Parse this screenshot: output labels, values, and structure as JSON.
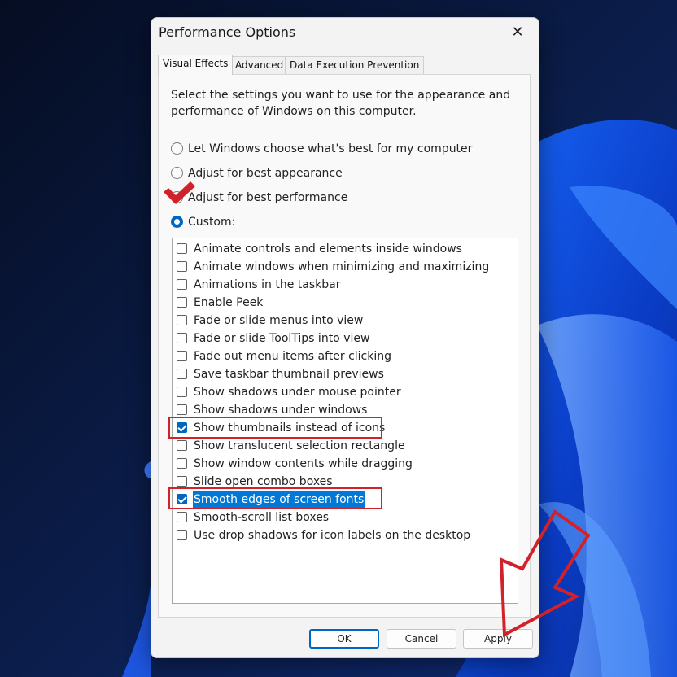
{
  "dialog": {
    "title": "Performance Options",
    "close_icon": "close-icon",
    "tabs": [
      {
        "label": "Visual Effects",
        "active": true
      },
      {
        "label": "Advanced",
        "active": false
      },
      {
        "label": "Data Execution Prevention",
        "active": false
      }
    ],
    "intro": "Select the settings you want to use for the appearance and performance of Windows on this computer.",
    "radio_options": [
      {
        "label": "Let Windows choose what's best for my computer",
        "checked": false
      },
      {
        "label": "Adjust for best appearance",
        "checked": false
      },
      {
        "label": "Adjust for best performance",
        "checked": false
      },
      {
        "label": "Custom:",
        "checked": true
      }
    ],
    "effects": [
      {
        "label": "Animate controls and elements inside windows",
        "checked": false
      },
      {
        "label": "Animate windows when minimizing and maximizing",
        "checked": false
      },
      {
        "label": "Animations in the taskbar",
        "checked": false
      },
      {
        "label": "Enable Peek",
        "checked": false
      },
      {
        "label": "Fade or slide menus into view",
        "checked": false
      },
      {
        "label": "Fade or slide ToolTips into view",
        "checked": false
      },
      {
        "label": "Fade out menu items after clicking",
        "checked": false
      },
      {
        "label": "Save taskbar thumbnail previews",
        "checked": false
      },
      {
        "label": "Show shadows under mouse pointer",
        "checked": false
      },
      {
        "label": "Show shadows under windows",
        "checked": false
      },
      {
        "label": "Show thumbnails instead of icons",
        "checked": true
      },
      {
        "label": "Show translucent selection rectangle",
        "checked": false
      },
      {
        "label": "Show window contents while dragging",
        "checked": false
      },
      {
        "label": "Slide open combo boxes",
        "checked": false
      },
      {
        "label": "Smooth edges of screen fonts",
        "checked": true,
        "selected": true
      },
      {
        "label": "Smooth-scroll list boxes",
        "checked": false
      },
      {
        "label": "Use drop shadows for icon labels on the desktop",
        "checked": false
      }
    ],
    "buttons": {
      "ok": "OK",
      "cancel": "Cancel",
      "apply": "Apply"
    }
  },
  "annotations": {
    "color": "#d1222a",
    "checkmark_icon": "checkmark-icon",
    "arrow_icon": "arrow-icon"
  }
}
